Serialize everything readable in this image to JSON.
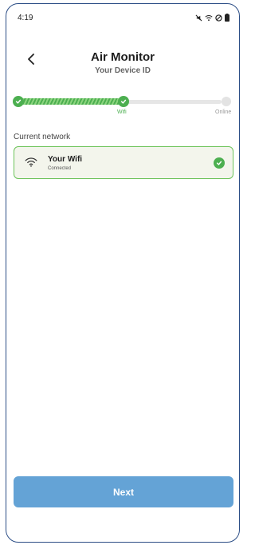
{
  "status_bar": {
    "time": "4:19"
  },
  "header": {
    "title": "Air Monitor",
    "subtitle": "Your Device ID"
  },
  "progress": {
    "steps": [
      "",
      "Wifi",
      "Online"
    ],
    "completed": 2,
    "total": 3
  },
  "network": {
    "section_label": "Current network",
    "name": "Your Wifi",
    "status": "Connected",
    "connected": true
  },
  "footer": {
    "next_label": "Next"
  },
  "colors": {
    "accent_green": "#4caf50",
    "primary_button": "#64a3d6",
    "frame_border": "#2c4e86"
  },
  "icons": [
    "mute-icon",
    "wifi-icon",
    "dnd-icon",
    "battery-icon",
    "back-arrow-icon",
    "check-icon"
  ]
}
